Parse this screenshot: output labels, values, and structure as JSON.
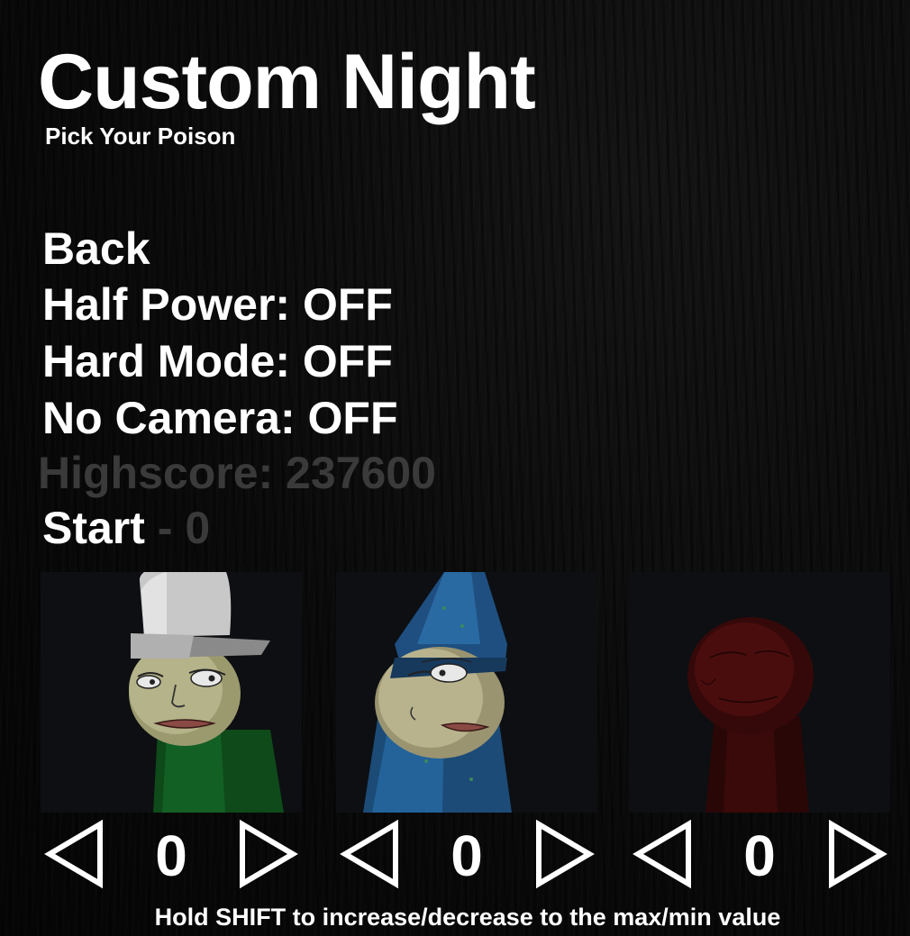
{
  "header": {
    "title": "Custom Night",
    "subtitle": "Pick Your Poison"
  },
  "menu": {
    "back": "Back",
    "half_power": "Half Power: OFF",
    "hard_mode": "Hard Mode: OFF",
    "no_camera": "No Camera: OFF",
    "highscore": "Highscore: 237600",
    "start_label": "Start",
    "start_separator": " - ",
    "start_score": "0"
  },
  "characters": [
    {
      "name": "top-hat-character",
      "level": "0"
    },
    {
      "name": "wizard-hat-character",
      "level": "0"
    },
    {
      "name": "red-shadow-character",
      "level": "0"
    }
  ],
  "footer": {
    "hint": "Hold SHIFT to increase/decrease to the max/min value"
  },
  "colors": {
    "background": "#070707",
    "text": "#ffffff",
    "dim_text": "#3a3a3a",
    "portrait_bg": "#0d0f12"
  }
}
